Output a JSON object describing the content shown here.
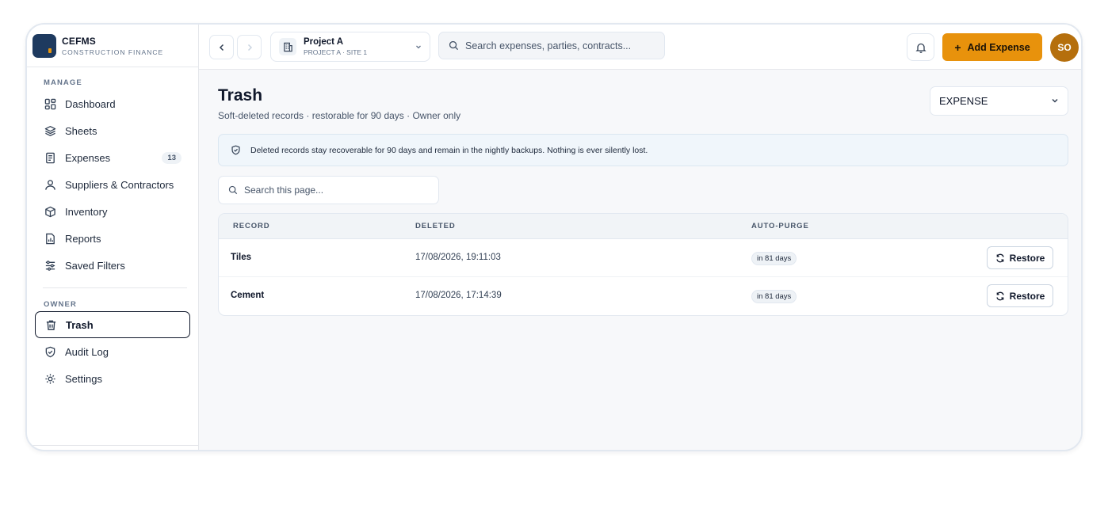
{
  "brand": {
    "name": "CEFMS",
    "subtitle": "CONSTRUCTION FINANCE"
  },
  "sidebar": {
    "manage_label": "MANAGE",
    "manage_items": [
      {
        "label": "Dashboard",
        "icon": "dashboard-grid-icon"
      },
      {
        "label": "Sheets",
        "icon": "layers-icon"
      },
      {
        "label": "Expenses",
        "icon": "receipt-icon",
        "badge": "13"
      },
      {
        "label": "Suppliers & Contractors",
        "icon": "user-icon"
      },
      {
        "label": "Inventory",
        "icon": "box-icon"
      },
      {
        "label": "Reports",
        "icon": "report-icon"
      },
      {
        "label": "Saved Filters",
        "icon": "sliders-icon"
      }
    ],
    "owner_label": "OWNER",
    "owner_items": [
      {
        "label": "Trash",
        "icon": "trash-icon",
        "active": true
      },
      {
        "label": "Audit Log",
        "icon": "shield-check-icon"
      },
      {
        "label": "Settings",
        "icon": "gear-icon"
      }
    ]
  },
  "topbar": {
    "project_name": "Project A",
    "project_sub": "PROJECT A · SITE 1",
    "search_placeholder": "Search expenses, parties, contracts...",
    "add_expense_label": "Add Expense",
    "avatar_initials": "SO"
  },
  "page": {
    "title": "Trash",
    "subtitle": "Soft-deleted records · restorable for 90 days · Owner only",
    "type_filter": "EXPENSE",
    "notice": "Deleted records stay recoverable for 90 days and remain in the nightly backups. Nothing is ever silently lost.",
    "search_placeholder": "Search this page..."
  },
  "table": {
    "headers": {
      "record": "RECORD",
      "deleted": "DELETED",
      "auto_purge": "AUTO-PURGE"
    },
    "rows": [
      {
        "record": "Tiles",
        "deleted": "17/08/2026, 19:11:03",
        "auto_purge": "in 81 days",
        "action": "Restore"
      },
      {
        "record": "Cement",
        "deleted": "17/08/2026, 17:14:39",
        "auto_purge": "in 81 days",
        "action": "Restore"
      }
    ]
  },
  "colors": {
    "accent": "#e8920c",
    "avatar": "#b56f0d",
    "brand": "#1e3a5f"
  }
}
